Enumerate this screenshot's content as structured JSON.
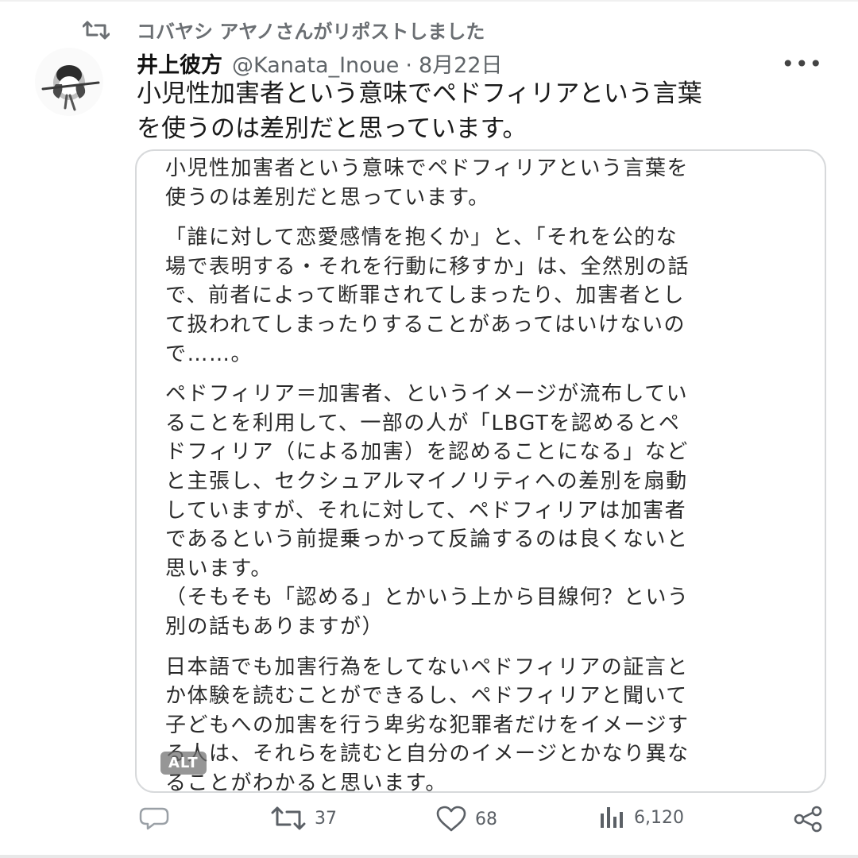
{
  "repost": {
    "icon": "repost-icon",
    "text": "コバヤシ アヤノさんがリポストしました"
  },
  "post": {
    "display_name": "井上彼方",
    "handle": "@Kanata_Inoue",
    "separator": "·",
    "date": "8月22日",
    "more_label": "•••",
    "text": "小児性加害者という意味でペドフィリアという言葉\nを使うのは差別だと思っています。"
  },
  "media": {
    "alt_badge": "ALT",
    "paragraphs": [
      "小児性加害者という意味でペドフィリアという言葉を\n使うのは差別だと思っています。",
      "「誰に対して恋愛感情を抱くか」と、「それを公的な\n場で表明する・それを行動に移すか」は、全然別の話\nで、前者によって断罪されてしまったり、加害者とし\nて扱われてしまったりすることがあってはいけないの\nで……。",
      "ペドフィリア＝加害者、というイメージが流布してい\nることを利用して、一部の人が「LBGTを認めるとペ\nドフィリア（による加害）を認めることになる」など\nと主張し、セクシュアルマイノリティへの差別を扇動\nしていますが、それに対して、ペドフィリアは加害者\nであるという前提乗っかって反論するのは良くないと\n思います。\n（そもそも「認める」とかいう上から目線何？という\n別の話もありますが）",
      "日本語でも加害行為をしてないペドフィリアの証言と\nか体験を読むことができるし、ペドフィリアと聞いて\n子どもへの加害を行う卑劣な犯罪者だけをイメージす\nる人は、それらを読むと自分のイメージとかなり異な\nることがわかると思います。"
    ]
  },
  "actions": {
    "reply": {
      "icon": "reply-icon",
      "count": ""
    },
    "repost": {
      "icon": "repost-icon",
      "count": "37"
    },
    "like": {
      "icon": "heart-icon",
      "count": "68"
    },
    "views": {
      "icon": "views-icon",
      "count": "6,120"
    },
    "share": {
      "icon": "share-icon"
    }
  },
  "colors": {
    "text": "#1a1a1a",
    "muted": "#5f6468",
    "border": "#d7d9db"
  }
}
